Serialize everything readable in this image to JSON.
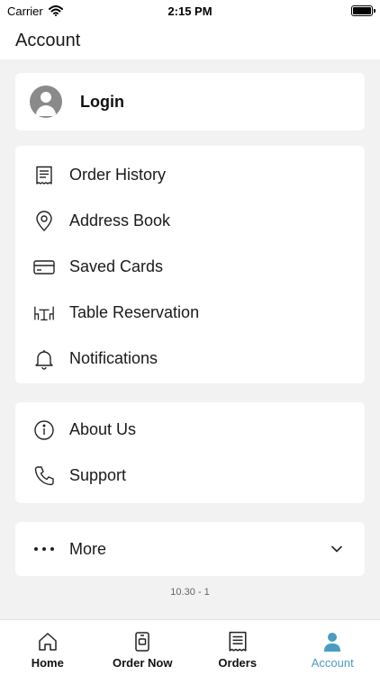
{
  "status_bar": {
    "carrier": "Carrier",
    "time": "2:15 PM"
  },
  "header": {
    "title": "Account"
  },
  "login": {
    "label": "Login",
    "icon": "avatar-icon"
  },
  "menu": [
    {
      "label": "Order History",
      "icon": "receipt-icon"
    },
    {
      "label": "Address Book",
      "icon": "location-pin-icon"
    },
    {
      "label": "Saved Cards",
      "icon": "credit-card-icon"
    },
    {
      "label": "Table Reservation",
      "icon": "table-chairs-icon"
    },
    {
      "label": "Notifications",
      "icon": "bell-icon"
    }
  ],
  "info_menu": [
    {
      "label": "About Us",
      "icon": "info-icon"
    },
    {
      "label": "Support",
      "icon": "phone-icon"
    }
  ],
  "more": {
    "label": "More",
    "icon": "ellipsis-icon"
  },
  "version": "10.30 - 1",
  "tabs": [
    {
      "label": "Home",
      "icon": "home-icon"
    },
    {
      "label": "Order Now",
      "icon": "order-icon"
    },
    {
      "label": "Orders",
      "icon": "receipt-icon"
    },
    {
      "label": "Account",
      "icon": "user-icon",
      "active": true
    }
  ],
  "colors": {
    "accent": "#4a9cc0",
    "background": "#f2f2f2",
    "card": "#ffffff"
  }
}
